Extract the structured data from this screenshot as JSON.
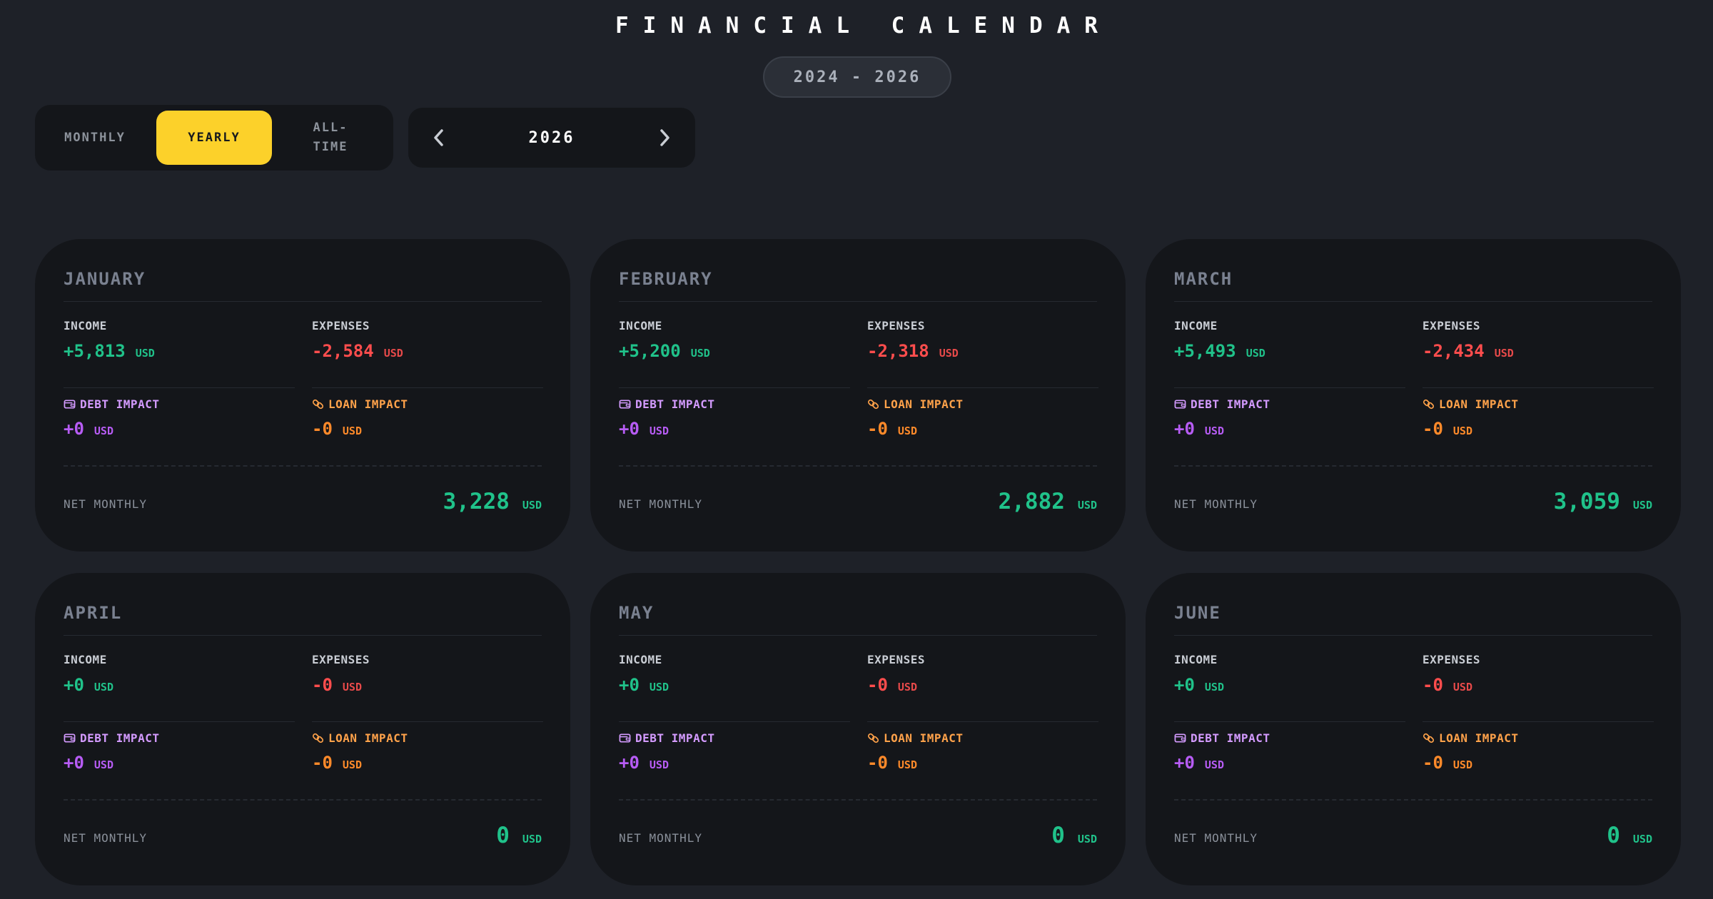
{
  "header": {
    "title": "FINANCIAL CALENDAR",
    "range": "2024 - 2026"
  },
  "view_toggle": {
    "options": [
      "MONTHLY",
      "YEARLY",
      "ALL-\nTIME"
    ],
    "selected": "YEARLY"
  },
  "year_nav": {
    "year": "2026",
    "prev_icon": "chevron-left-icon",
    "next_icon": "chevron-right-icon"
  },
  "labels": {
    "income": "INCOME",
    "expenses": "EXPENSES",
    "debt_impact": "DEBT IMPACT",
    "loan_impact": "LOAN IMPACT",
    "net_monthly": "NET MONTHLY",
    "currency": "USD",
    "debt_icon": "wallet-icon",
    "loan_icon": "link-icon"
  },
  "months": [
    {
      "name": "JANUARY",
      "income": "+5,813",
      "expenses": "-2,584",
      "debt": "+0",
      "loan": "-0",
      "net": "3,228"
    },
    {
      "name": "FEBRUARY",
      "income": "+5,200",
      "expenses": "-2,318",
      "debt": "+0",
      "loan": "-0",
      "net": "2,882"
    },
    {
      "name": "MARCH",
      "income": "+5,493",
      "expenses": "-2,434",
      "debt": "+0",
      "loan": "-0",
      "net": "3,059"
    },
    {
      "name": "APRIL",
      "income": "+0",
      "expenses": "-0",
      "debt": "+0",
      "loan": "-0",
      "net": "0"
    },
    {
      "name": "MAY",
      "income": "+0",
      "expenses": "-0",
      "debt": "+0",
      "loan": "-0",
      "net": "0"
    },
    {
      "name": "JUNE",
      "income": "+0",
      "expenses": "-0",
      "debt": "+0",
      "loan": "-0",
      "net": "0"
    }
  ],
  "colors": {
    "accent_yellow": "#fcd12a",
    "income_green": "#20c28a",
    "expense_red": "#ff4d4d",
    "debt_purple": "#b75cf5",
    "loan_orange": "#ff8a2a"
  }
}
